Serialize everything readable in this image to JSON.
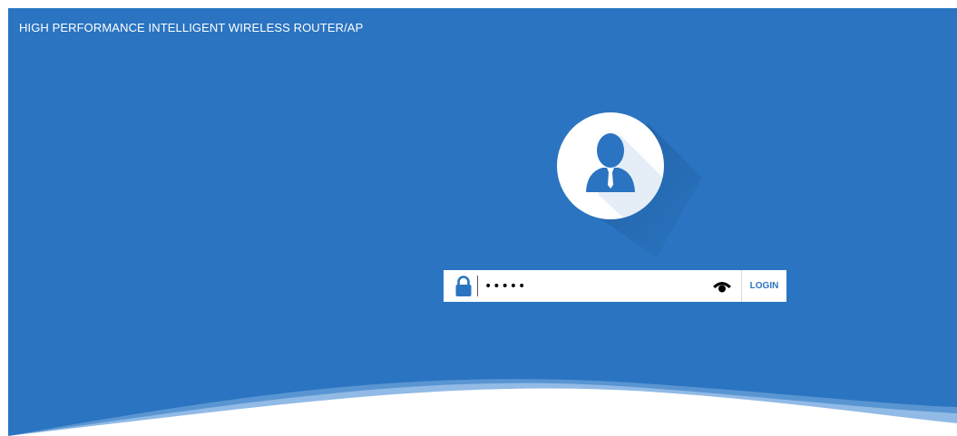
{
  "header": {
    "title": "HIGH PERFORMANCE INTELLIGENT WIRELESS ROUTER/AP"
  },
  "login": {
    "password_value": "•••••",
    "button_label": "LOGIN"
  },
  "icons": {
    "avatar": "user-avatar-icon",
    "lock": "lock-icon",
    "eye": "eye-icon"
  },
  "colors": {
    "background": "#2a74c1",
    "accent": "#2a74c1",
    "panel": "#ffffff"
  }
}
